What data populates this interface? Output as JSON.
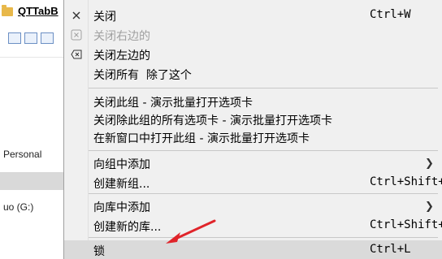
{
  "window": {
    "tab_title": "QTTabB",
    "sidebar": {
      "item_personal": "Personal",
      "item_drive": "uo (G:)"
    }
  },
  "menu": {
    "close": {
      "label": "关闭",
      "shortcut": "Ctrl+W"
    },
    "close_right": {
      "label": "关闭右边的"
    },
    "close_left": {
      "label": "关闭左边的"
    },
    "close_all_except": {
      "label": "关闭所有  除了这个"
    },
    "group_close": {
      "label": "关闭此组 - 演示批量打开选项卡"
    },
    "group_close_others": {
      "label": "关闭除此组的所有选项卡 - 演示批量打开选项卡"
    },
    "group_new_window": {
      "label": "在新窗口中打开此组 - 演示批量打开选项卡"
    },
    "add_to_group": {
      "label": "向组中添加"
    },
    "create_group": {
      "label": "创建新组...",
      "shortcut": "Ctrl+Shift+G"
    },
    "add_to_library": {
      "label": "向库中添加"
    },
    "create_library": {
      "label": "创建新的库...",
      "shortcut": "Ctrl+Shift+L"
    },
    "lock": {
      "label": "锁",
      "shortcut": "Ctrl+L"
    }
  },
  "colors": {
    "annotation_arrow": "#e0242a",
    "menu_bg": "#f0f0f0",
    "hover": "#dadada"
  }
}
